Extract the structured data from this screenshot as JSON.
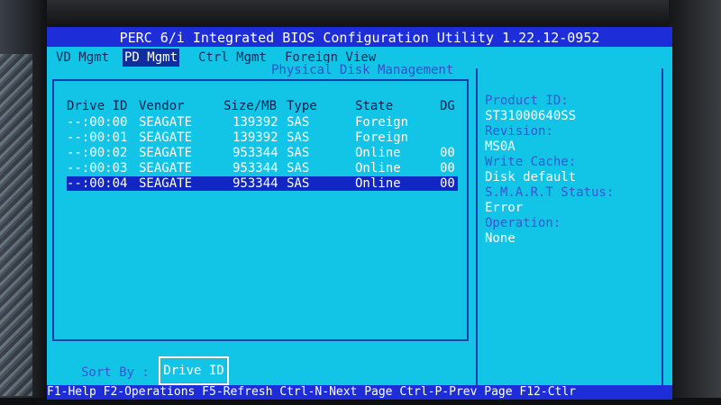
{
  "title": "PERC 6/i Integrated BIOS Configuration Utility 1.22.12-0952",
  "menu": [
    "VD Mgmt",
    "PD Mgmt",
    "Ctrl Mgmt",
    "Foreign View"
  ],
  "panel_title": "Physical Disk Management",
  "table": {
    "headers": [
      "Drive ID",
      "Vendor",
      "Size/MB",
      "Type",
      "State",
      "DG"
    ],
    "rows": [
      {
        "id": "--:00:00",
        "vendor": "SEAGATE",
        "size": "139392",
        "type": "SAS",
        "state": "Foreign",
        "dg": ""
      },
      {
        "id": "--:00:01",
        "vendor": "SEAGATE",
        "size": "139392",
        "type": "SAS",
        "state": "Foreign",
        "dg": ""
      },
      {
        "id": "--:00:02",
        "vendor": "SEAGATE",
        "size": "953344",
        "type": "SAS",
        "state": "Online",
        "dg": "00"
      },
      {
        "id": "--:00:03",
        "vendor": "SEAGATE",
        "size": "953344",
        "type": "SAS",
        "state": "Online",
        "dg": "00"
      },
      {
        "id": "--:00:04",
        "vendor": "SEAGATE",
        "size": "953344",
        "type": "SAS",
        "state": "Online",
        "dg": "00"
      }
    ]
  },
  "info": {
    "product_id_label": "Product ID:",
    "product_id": "ST31000640SS",
    "revision_label": "Revision:",
    "revision": "MS0A",
    "write_cache_label": "Write Cache:",
    "write_cache": "Disk default",
    "smart_label": "S.M.A.R.T Status:",
    "smart": "Error",
    "operation_label": "Operation:",
    "operation": "None"
  },
  "sort_label": "Sort By :",
  "sort_value": "Drive ID",
  "status": "F1-Help F2-Operations F5-Refresh Ctrl-N-Next Page Ctrl-P-Prev Page F12-Ctlr",
  "colors": {
    "screen": "#12c5e7",
    "titlebar": "#1d2ed8",
    "selection": "#1226c4",
    "label": "#3458cf"
  }
}
